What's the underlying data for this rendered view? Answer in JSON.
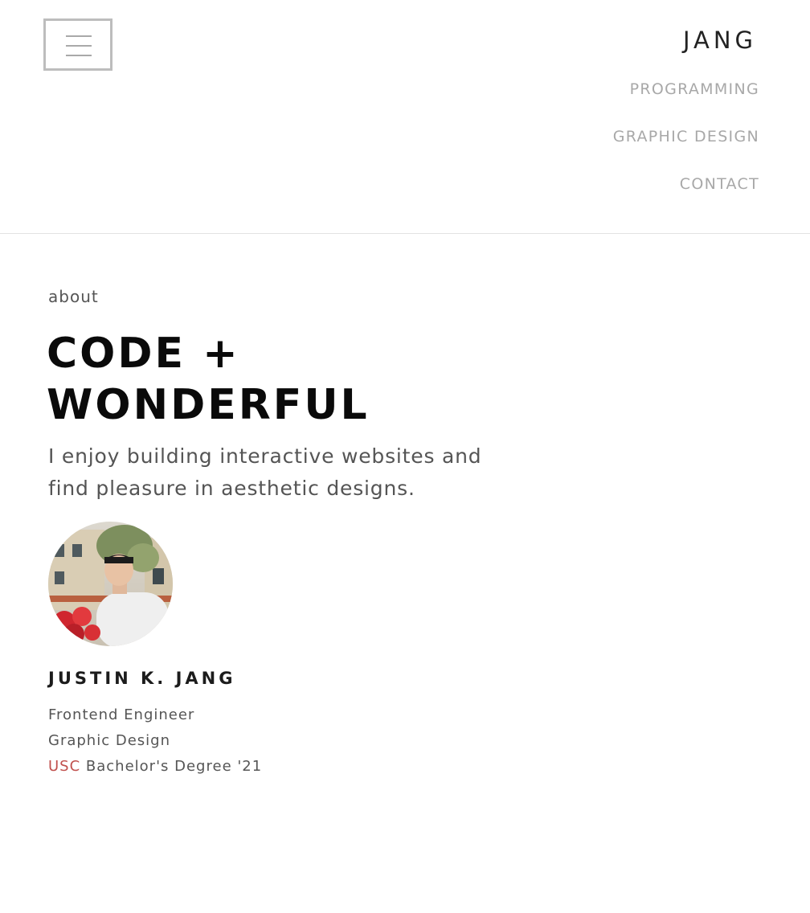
{
  "header": {
    "logo": "JANG",
    "menu_icon": "hamburger-menu-icon"
  },
  "nav": {
    "items": [
      {
        "label": "PROGRAMMING"
      },
      {
        "label": "GRAPHIC DESIGN"
      },
      {
        "label": "CONTACT"
      }
    ]
  },
  "about": {
    "section_label": "about",
    "headline_line1": "CODE +",
    "headline_line2": "WONDERFUL",
    "tagline": "I enjoy building interactive websites and find pleasure in aesthetic designs.",
    "name": "JUSTIN K. JANG",
    "role1": "Frontend Engineer",
    "role2": "Graphic Design",
    "school": "USC",
    "degree": "Bachelor's Degree '21"
  },
  "colors": {
    "nav_text": "#a8a8a8",
    "school_accent": "#c0504d",
    "headline": "#0a0a0a"
  }
}
